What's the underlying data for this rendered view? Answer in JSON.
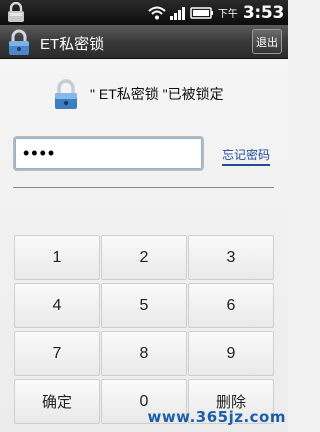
{
  "status_bar": {
    "ampm": "下午",
    "time": "3:53",
    "icons": [
      "lock-icon",
      "wifi-icon",
      "signal-icon",
      "battery-icon"
    ]
  },
  "title_bar": {
    "title": "ET私密锁",
    "exit_label": "退出"
  },
  "main": {
    "locked_message": "\" ET私密锁 \"已被锁定",
    "password_value": "••••",
    "forgot_label": "忘记密码"
  },
  "keypad": {
    "keys": [
      "1",
      "2",
      "3",
      "4",
      "5",
      "6",
      "7",
      "8",
      "9",
      "确定",
      "0",
      "删除"
    ]
  },
  "watermark": "www.365jz.com",
  "colors": {
    "title_bar": "#3a3a3a",
    "link": "#244a9a",
    "background": "#f2f2f2"
  }
}
